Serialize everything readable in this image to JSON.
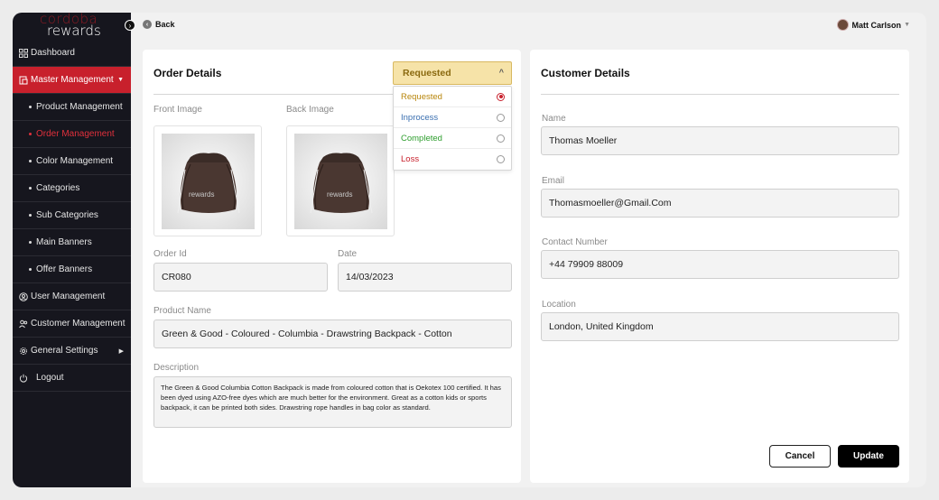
{
  "brand": {
    "line1": "cordoba",
    "line2": "rewards"
  },
  "sidebar": {
    "items": [
      {
        "label": "Dashboard",
        "icon": "grid-icon"
      },
      {
        "label": "Master Management",
        "icon": "folder-icon"
      },
      {
        "label": "Product Management"
      },
      {
        "label": "Order Management"
      },
      {
        "label": "Color Management"
      },
      {
        "label": "Categories"
      },
      {
        "label": "Sub Categories"
      },
      {
        "label": "Main Banners"
      },
      {
        "label": "Offer Banners"
      },
      {
        "label": "User Management",
        "icon": "user-circle-icon"
      },
      {
        "label": "Customer Management",
        "icon": "users-icon"
      },
      {
        "label": "General Settings",
        "icon": "gear-icon"
      },
      {
        "label": "Logout",
        "icon": "power-icon"
      }
    ]
  },
  "topbar": {
    "back_label": "Back",
    "user_name": "Matt Carlson"
  },
  "order": {
    "title": "Order Details",
    "status": {
      "selected": "Requested",
      "options": [
        {
          "label": "Requested",
          "color": "#b8860b"
        },
        {
          "label": "Inprocess",
          "color": "#3a6fb0"
        },
        {
          "label": "Completed",
          "color": "#2e9e2e"
        },
        {
          "label": "Loss",
          "color": "#c8202c"
        }
      ]
    },
    "front_image_label": "Front Image",
    "back_image_label": "Back Image",
    "bag_brand": "rewards",
    "order_id_label": "Order Id",
    "order_id": "CR080",
    "date_label": "Date",
    "date": "14/03/2023",
    "product_name_label": "Product Name",
    "product_name": "Green & Good - Coloured - Columbia - Drawstring Backpack - Cotton",
    "description_label": "Description",
    "description": "The Green & Good Columbia Cotton Backpack is made from coloured cotton that is Oekotex 100 certified. It has been dyed using AZO-free dyes which are much better for the environment. Great as a cotton kids or sports backpack, it can be printed both sides. Drawstring rope handles in bag color as standard."
  },
  "customer": {
    "title": "Customer Details",
    "name_label": "Name",
    "name": "Thomas Moeller",
    "email_label": "Email",
    "email": "Thomasmoeller@Gmail.Com",
    "contact_label": "Contact Number",
    "contact": "+44 79909 88009",
    "location_label": "Location",
    "location": "London, United Kingdom"
  },
  "actions": {
    "cancel_label": "Cancel",
    "update_label": "Update"
  }
}
